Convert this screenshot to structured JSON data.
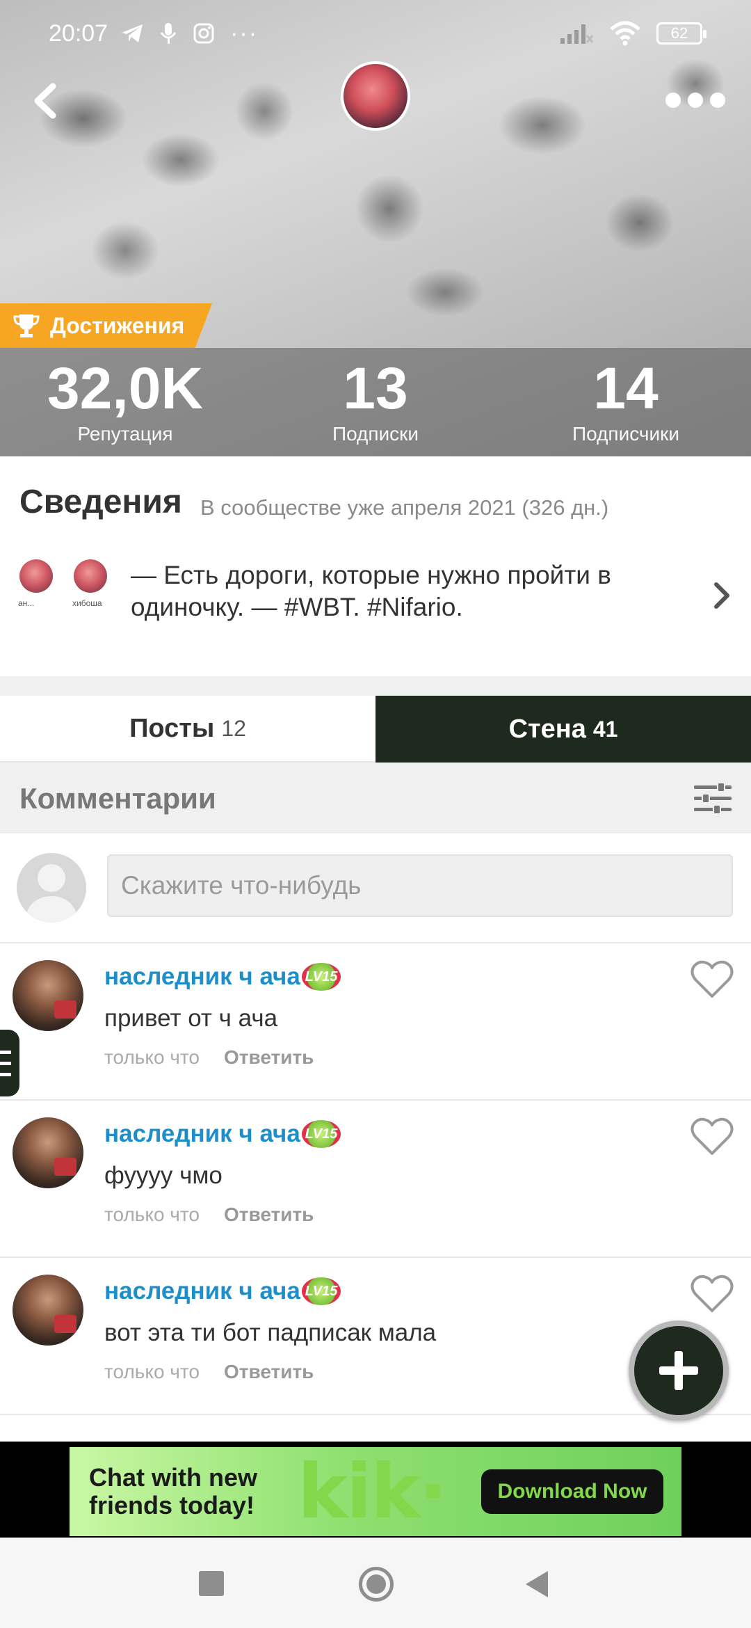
{
  "status_bar": {
    "time": "20:07",
    "more": "···",
    "battery": "62"
  },
  "profile": {
    "achievements_label": "Достижения",
    "stats": [
      {
        "value": "32,0K",
        "label": "Репутация"
      },
      {
        "value": "13",
        "label": "Подписки"
      },
      {
        "value": "14",
        "label": "Подписчики"
      }
    ]
  },
  "info": {
    "title": "Сведения",
    "since": "В сообществе уже апреля 2021 (326 дн.)",
    "linked_tags": [
      "ан...",
      "хибоша"
    ],
    "bio": "— Есть дороги, которые нужно пройти в одиночку. — #WBT. #Nifario."
  },
  "tabs": [
    {
      "label": "Посты",
      "count": "12"
    },
    {
      "label": "Стена",
      "count": "41"
    }
  ],
  "comments": {
    "title": "Комментарии",
    "compose_placeholder": "Скажите что-нибудь",
    "items": [
      {
        "author": "наследник ч ача",
        "level": "LV15",
        "text": "привет от ч ача",
        "time": "только что",
        "reply": "Ответить"
      },
      {
        "author": "наследник ч ача",
        "level": "LV15",
        "text": "фуууу чмо",
        "time": "только что",
        "reply": "Ответить"
      },
      {
        "author": "наследник ч ача",
        "level": "LV15",
        "text": "вот эта ти бот падписак мала",
        "time": "только что",
        "reply": "Ответить"
      }
    ]
  },
  "ad": {
    "headline": "Chat with new friends today!",
    "brand": "kik·",
    "cta": "Download Now"
  },
  "colors": {
    "accent_dark": "#1e2a1e",
    "author_blue": "#1e8ecb",
    "achievement_orange": "#f6a623"
  }
}
